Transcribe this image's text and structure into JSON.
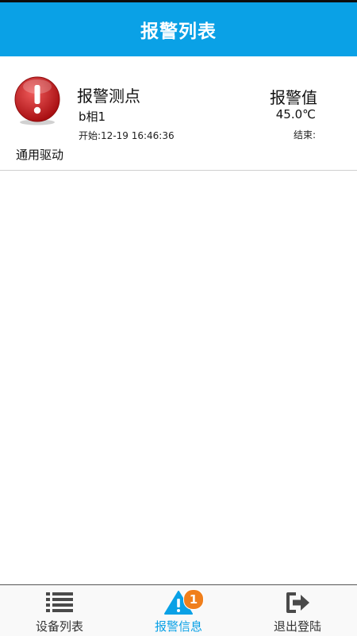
{
  "header": {
    "title": "报警列表"
  },
  "alarm": {
    "point_label": "报警测点",
    "point_value": "b相1",
    "start_time": "开始:12-19 16:46:36",
    "driver_name": "通用驱动",
    "value_label": "报警值",
    "value_number": "45.0℃",
    "end_time": "结束:"
  },
  "bottom_nav": {
    "items": [
      {
        "label": "设备列表",
        "icon": "list-icon"
      },
      {
        "label": "报警信息",
        "icon": "warning-icon",
        "badge": "1"
      },
      {
        "label": "退出登陆",
        "icon": "logout-icon"
      }
    ]
  },
  "colors": {
    "header_bg": "#0aa1e6",
    "alarm_red": "#d42a2a",
    "badge_orange": "#f07f1c",
    "active_tab": "#0aa1e6"
  }
}
